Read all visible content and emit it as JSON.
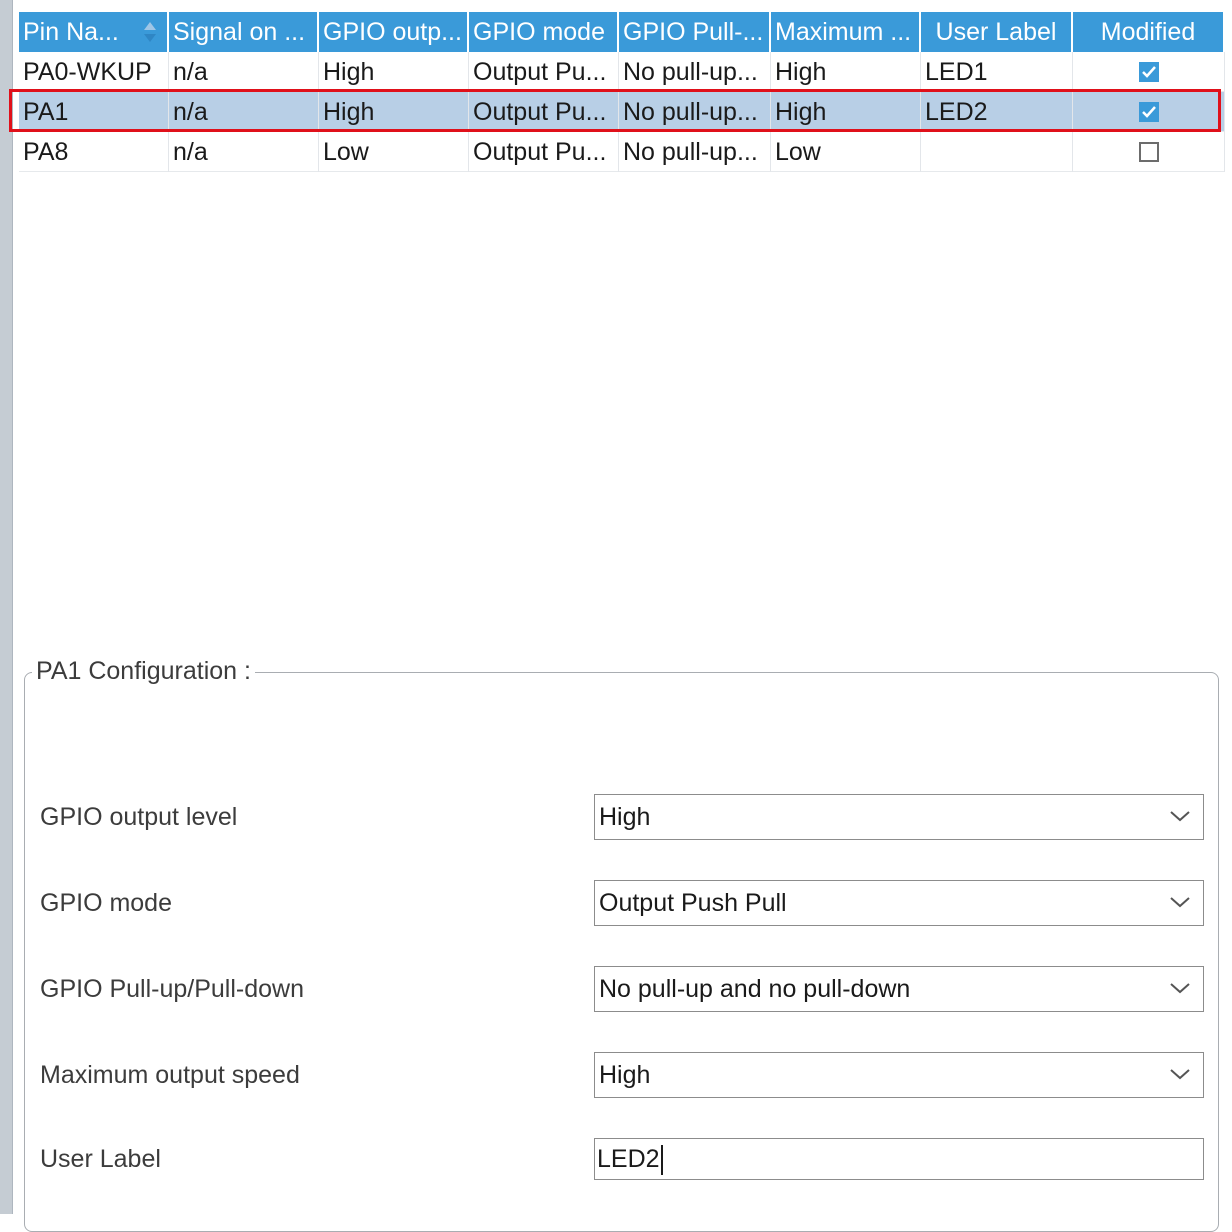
{
  "table": {
    "columns": [
      {
        "label": "Pin Na...",
        "sortable": true
      },
      {
        "label": "Signal on ..."
      },
      {
        "label": "GPIO outp..."
      },
      {
        "label": "GPIO mode"
      },
      {
        "label": "GPIO Pull-..."
      },
      {
        "label": "Maximum ..."
      },
      {
        "label": "User Label"
      },
      {
        "label": "Modified"
      }
    ],
    "rows": [
      {
        "pin": "PA0-WKUP",
        "signal": "n/a",
        "output": "High",
        "mode": "Output Pu...",
        "pull": "No pull-up...",
        "speed": "High",
        "label": "LED1",
        "modified": true
      },
      {
        "pin": "PA1",
        "signal": "n/a",
        "output": "High",
        "mode": "Output Pu...",
        "pull": "No pull-up...",
        "speed": "High",
        "label": "LED2",
        "modified": true,
        "selected": true
      },
      {
        "pin": "PA8",
        "signal": "n/a",
        "output": "Low",
        "mode": "Output Pu...",
        "pull": "No pull-up...",
        "speed": "Low",
        "label": "",
        "modified": false
      }
    ]
  },
  "config": {
    "title": "PA1 Configuration :",
    "fields": [
      {
        "label": "GPIO output level",
        "value": "High"
      },
      {
        "label": "GPIO mode",
        "value": "Output Push Pull"
      },
      {
        "label": "GPIO Pull-up/Pull-down",
        "value": "No pull-up and no pull-down"
      },
      {
        "label": "Maximum output speed",
        "value": "High"
      }
    ],
    "user_label": {
      "label": "User Label",
      "value": "LED2"
    }
  },
  "colors": {
    "header_bg": "#3a9ad9",
    "selected_row_bg": "#b8cfe6",
    "highlight_outline": "#e0101a"
  }
}
